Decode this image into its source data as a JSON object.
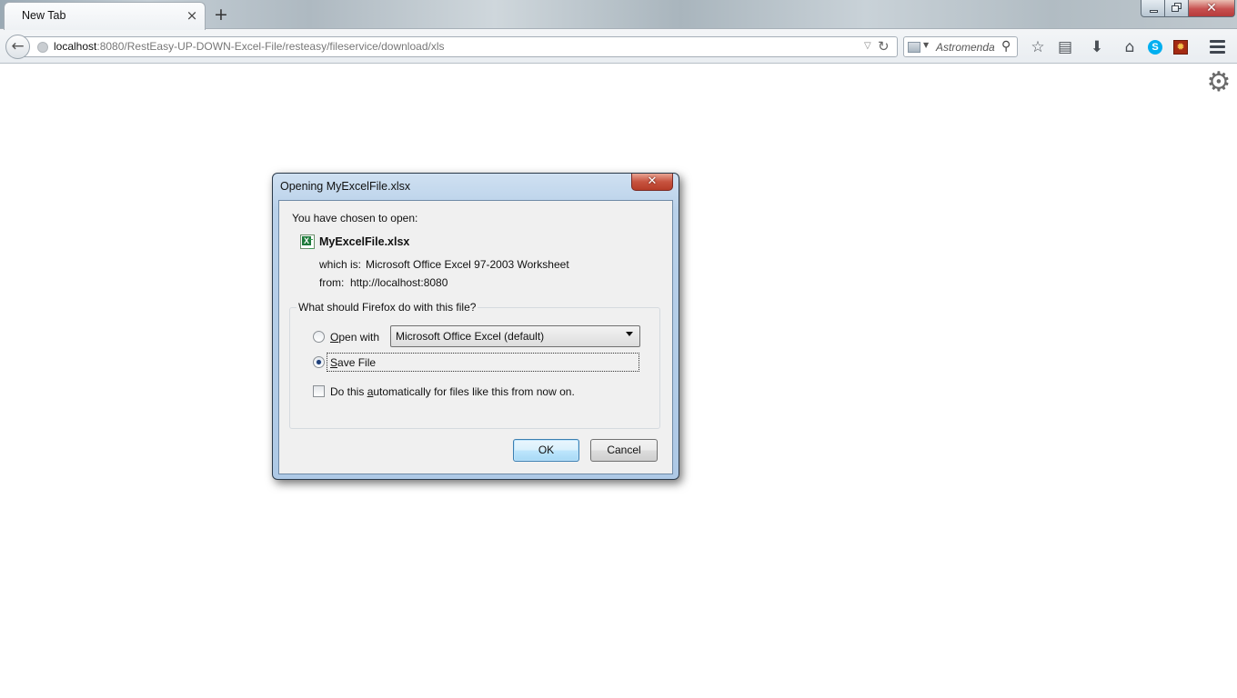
{
  "browser": {
    "tab": {
      "title": "New Tab",
      "close_glyph": "×"
    },
    "new_tab_glyph": "+",
    "url": {
      "host": "localhost",
      "rest": ":8080/RestEasy-UP-DOWN-Excel-File/resteasy/fileservice/download/xls"
    },
    "search": {
      "placeholder": "Astromenda",
      "engine_icon": "search-engine-icon"
    },
    "toolbar_icons": [
      "bookmark-star-icon",
      "reading-list-icon",
      "downloads-icon",
      "home-icon",
      "skype-icon",
      "extension-icon",
      "menu-icon"
    ],
    "window_close_glyph": "✕"
  },
  "dialog": {
    "title": "Opening MyExcelFile.xlsx",
    "close_glyph": "✕",
    "intro": "You have chosen to open:",
    "file_name": "MyExcelFile.xlsx",
    "which_is_label": "which is:",
    "which_is_value": "Microsoft Office Excel 97-2003 Worksheet",
    "from_label": "from:",
    "from_value": "http://localhost:8080",
    "question": "What should Firefox do with this file?",
    "open_with": {
      "label_key": "O",
      "label_rest": "pen with",
      "selected": false,
      "app": "Microsoft Office Excel (default)"
    },
    "save_file": {
      "label_key": "S",
      "label_rest": "ave File",
      "selected": true
    },
    "auto": {
      "label_pre": "Do this ",
      "label_key": "a",
      "label_rest": "utomatically for files like this from now on.",
      "checked": false
    },
    "ok_label": "OK",
    "cancel_label": "Cancel"
  },
  "colors": {
    "dialog_frame": "#b9d1ea",
    "dialog_body": "#f0f0f0",
    "close_red": "#c7533f",
    "ok_blue": "#3c7fb1"
  }
}
